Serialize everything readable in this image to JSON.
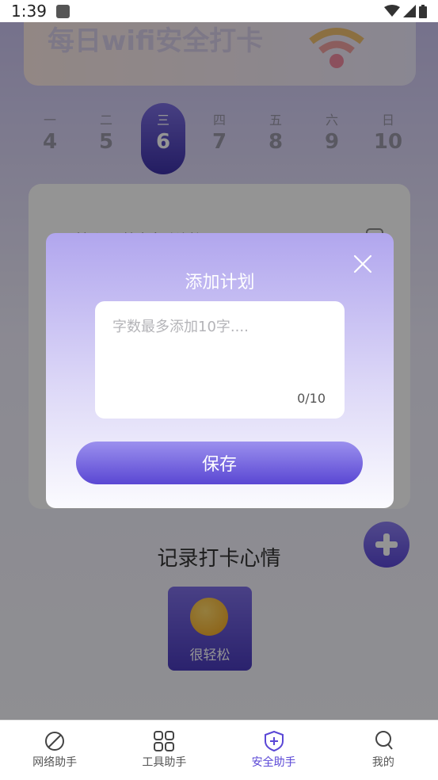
{
  "status_bar": {
    "time": "1:39"
  },
  "banner": {
    "title": "每日wifi安全打卡"
  },
  "week": [
    {
      "weekday": "一",
      "date": "4",
      "active": false
    },
    {
      "weekday": "二",
      "date": "5",
      "active": false
    },
    {
      "weekday": "三",
      "date": "6",
      "active": true
    },
    {
      "weekday": "四",
      "date": "7",
      "active": false
    },
    {
      "weekday": "五",
      "date": "8",
      "active": false
    },
    {
      "weekday": "六",
      "date": "9",
      "active": false
    },
    {
      "weekday": "日",
      "date": "10",
      "active": false
    }
  ],
  "plan_card": {
    "item_text": "手机设置禁止自动连接WIFI"
  },
  "mood": {
    "title": "记录打卡心情",
    "label": "很轻松"
  },
  "dialog": {
    "title": "添加计划",
    "input_placeholder": "字数最多添加10字....",
    "input_value": "",
    "counter": "0/10",
    "save_label": "保存"
  },
  "bottom_nav": [
    {
      "label": "网络助手",
      "icon": "leaf-icon",
      "active": false
    },
    {
      "label": "工具助手",
      "icon": "grid-icon",
      "active": false
    },
    {
      "label": "安全助手",
      "icon": "shield-plus-icon",
      "active": true
    },
    {
      "label": "我的",
      "icon": "person-icon",
      "active": false
    }
  ],
  "colors": {
    "accent": "#5a47d6",
    "dialog_top": "#b1a6ee"
  }
}
